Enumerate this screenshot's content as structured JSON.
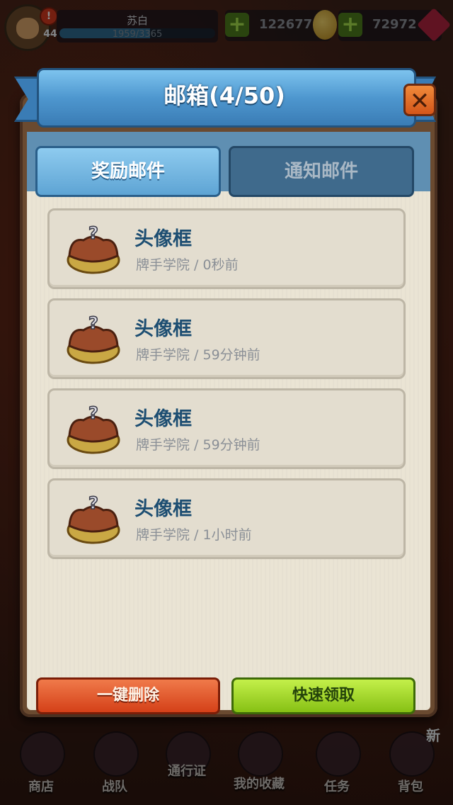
{
  "hud": {
    "player_name": "苏白",
    "level": "44",
    "xp_text": "1959/3365",
    "xp_progress": 0.582,
    "avatar_alert": "!",
    "gold": "122677",
    "gems": "72972"
  },
  "mailbox": {
    "title": "邮箱(4/50)",
    "close_label": "✕",
    "tabs": [
      {
        "label": "奖励邮件",
        "active": true
      },
      {
        "label": "通知邮件",
        "active": false
      }
    ],
    "mails": [
      {
        "title": "头像框",
        "subtitle": "牌手学院 / 0秒前"
      },
      {
        "title": "头像框",
        "subtitle": "牌手学院 / 59分钟前"
      },
      {
        "title": "头像框",
        "subtitle": "牌手学院 / 59分钟前"
      },
      {
        "title": "头像框",
        "subtitle": "牌手学院 / 1小时前"
      }
    ],
    "delete_all_label": "一键删除",
    "claim_all_label": "快速领取"
  },
  "bottom_nav": {
    "items": [
      {
        "label": "商店",
        "icon": "shop-icon"
      },
      {
        "label": "战队",
        "icon": "team-icon"
      },
      {
        "label": "通行证",
        "icon": "pass-icon"
      },
      {
        "label": "我的收藏",
        "icon": "collection-icon"
      },
      {
        "label": "任务",
        "icon": "task-icon"
      },
      {
        "label": "背包",
        "icon": "bag-icon"
      }
    ],
    "new_badge": "新"
  },
  "colors": {
    "ribbon_blue": "#4e97cf",
    "title_text_blue": "#1d4e72",
    "delete_red": "#d44018",
    "claim_green": "#86c014",
    "close_orange": "#e06a24"
  }
}
